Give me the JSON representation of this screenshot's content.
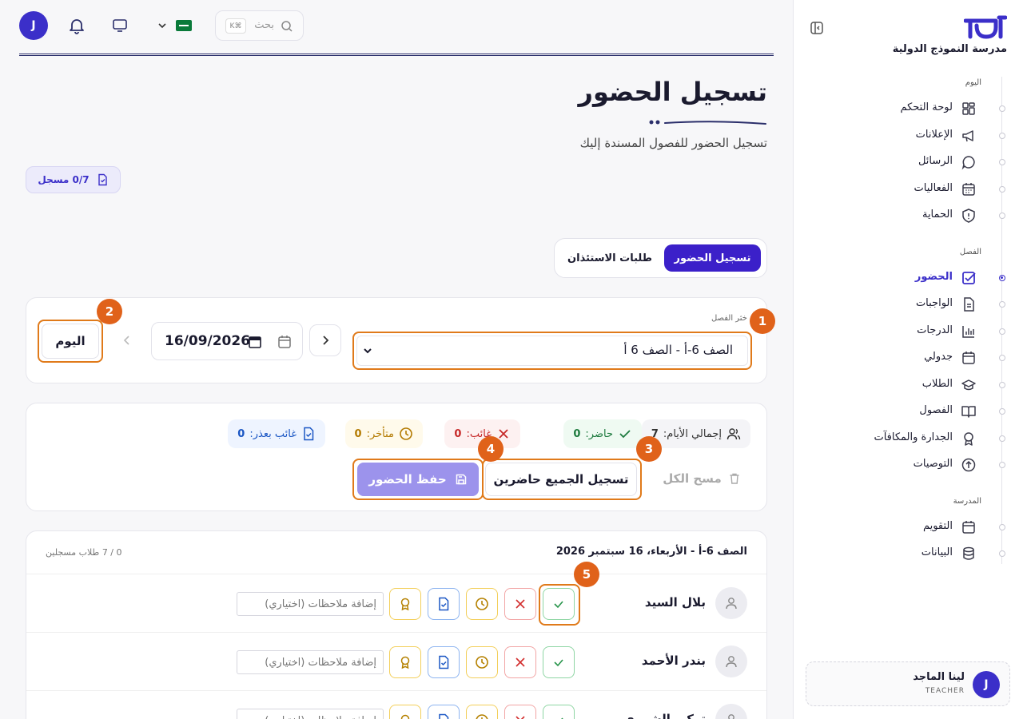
{
  "school": {
    "name": "مدرسة النموذج الدولية"
  },
  "sidebar": {
    "sections": [
      {
        "label": "اليوم"
      },
      {
        "label": "الفصل"
      },
      {
        "label": "المدرسة"
      }
    ],
    "items": [
      {
        "label": "لوحة التحكم",
        "icon": "dashboard-icon"
      },
      {
        "label": "الإعلانات",
        "icon": "megaphone-icon"
      },
      {
        "label": "الرسائل",
        "icon": "chat-icon"
      },
      {
        "label": "الفعاليات",
        "icon": "calendar-grid-icon"
      },
      {
        "label": "الحماية",
        "icon": "shield-icon"
      },
      {
        "label": "الحضور",
        "icon": "check-square-icon",
        "active": true
      },
      {
        "label": "الواجبات",
        "icon": "document-icon"
      },
      {
        "label": "الدرجات",
        "icon": "bar-chart-icon"
      },
      {
        "label": "جدولي",
        "icon": "calendar-icon"
      },
      {
        "label": "الطلاب",
        "icon": "graduation-cap-icon"
      },
      {
        "label": "الفصول",
        "icon": "book-icon"
      },
      {
        "label": "الجدارة والمكافآت",
        "icon": "award-icon"
      },
      {
        "label": "التوصيات",
        "icon": "arrow-up-circle-icon"
      },
      {
        "label": "التقويم",
        "icon": "calendar-icon"
      },
      {
        "label": "البيانات",
        "icon": "database-icon"
      }
    ]
  },
  "user": {
    "name": "لينا الماجد",
    "role": "TEACHER",
    "initial": "J"
  },
  "topbar": {
    "avatar_initial": "J",
    "search_placeholder": "بحث",
    "search_shortcut": "K⌘"
  },
  "page": {
    "title": "تسجيل الحضور",
    "subtitle": "تسجيل الحضور للفصول المسندة إليك",
    "status_chip": "0/7 مسجل"
  },
  "tabs": {
    "active": "تسجيل الحضور",
    "other": "طلبات الاستئذان"
  },
  "filter": {
    "class_label": "خثر الفصل",
    "class_value": "الصف 6-أ - الصف 6 أ",
    "date_value": "16/09/2026",
    "today_label": "اليوم"
  },
  "stats": {
    "total_label": "إجمالي الأيام:",
    "total_value": "7",
    "present_label": "حاضر:",
    "present_value": "0",
    "absent_label": "غائب:",
    "absent_value": "0",
    "late_label": "متأخر:",
    "late_value": "0",
    "excused_label": "غائب بعذر:",
    "excused_value": "0"
  },
  "actions": {
    "clear_all": "مسح الكل",
    "mark_all_present": "تسجيل الجميع حاضرين",
    "save": "حفظ الحضور"
  },
  "markers": [
    "1",
    "2",
    "3",
    "4",
    "5"
  ],
  "list": {
    "title": "الصف 6-أ - الأربعاء، 16 سبتمبر 2026",
    "count": "0 / 7 طلاب مسجلين",
    "note_placeholder": "إضافة ملاحظات (اختياري)",
    "students": [
      {
        "name": "بلال السيد"
      },
      {
        "name": "بندر الأحمد"
      },
      {
        "name": "تركي الشمري"
      }
    ]
  },
  "colors": {
    "accent": "#3b20c9",
    "highlight": "#e07a1a",
    "present": "#27944a",
    "absent": "#d32f2f",
    "late": "#b58100",
    "excused": "#1a56c4"
  }
}
